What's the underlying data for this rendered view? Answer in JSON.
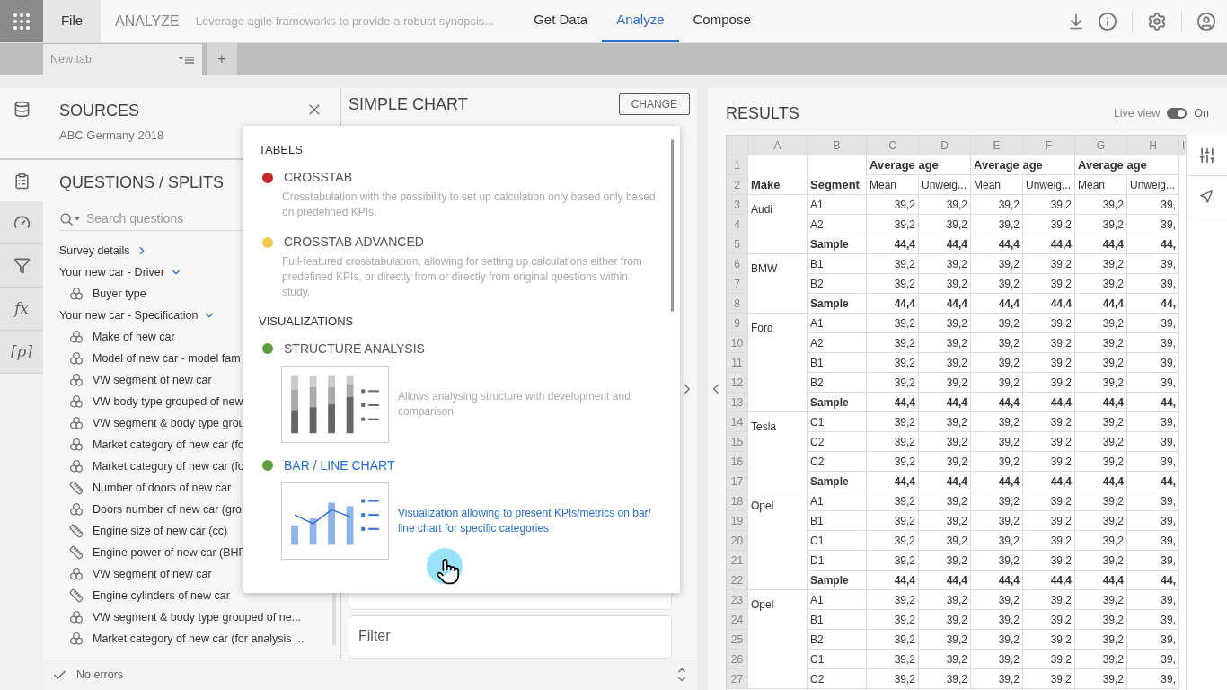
{
  "topbar": {
    "file_tab": "File",
    "title": "ANALYZE",
    "subtitle": "Leverage agile frameworks to provide a robust synopsis...",
    "nav": [
      {
        "label": "Get Data",
        "selected": false
      },
      {
        "label": "Analyze",
        "selected": true
      },
      {
        "label": "Compose",
        "selected": false
      }
    ]
  },
  "tabstrip": {
    "tabs": [
      {
        "label": "New tab"
      }
    ],
    "add_label": "+"
  },
  "rail": [
    {
      "kind": "gauge"
    },
    {
      "kind": "filter"
    },
    {
      "kind": "text",
      "label": "fx"
    },
    {
      "kind": "text",
      "label": "[p]"
    }
  ],
  "sources": {
    "title": "SOURCES",
    "subtitle": "ABC Germany 2018"
  },
  "questions": {
    "title": "QUESTIONS / SPLITS",
    "search": {
      "placeholder": "Search questions"
    },
    "groups": [
      {
        "label": "Survey details",
        "expanded": false
      },
      {
        "label": "Your new car - Driver",
        "expanded": true,
        "items": [
          {
            "label": "Buyer type",
            "kind": "categorical"
          }
        ]
      },
      {
        "label": "Your new car - Specification",
        "expanded": true,
        "items": [
          {
            "label": "Make of new car",
            "kind": "categorical"
          },
          {
            "label": "Model of new car - model fam",
            "kind": "categorical"
          },
          {
            "label": "VW segment of new car",
            "kind": "categorical"
          },
          {
            "label": "VW body type grouped of new",
            "kind": "categorical"
          },
          {
            "label": "VW segment & body type grou",
            "kind": "categorical"
          },
          {
            "label": "Market category of new car (fo",
            "kind": "categorical"
          },
          {
            "label": "Market category of new car (fo",
            "kind": "categorical"
          },
          {
            "label": "Number of doors of new car",
            "kind": "numeric"
          },
          {
            "label": "Doors number of new car (gro",
            "kind": "categorical"
          },
          {
            "label": "Engine size of new car (cc)",
            "kind": "numeric"
          },
          {
            "label": "Engine power of new car (BHP",
            "kind": "numeric"
          },
          {
            "label": "VW segment of new car",
            "kind": "categorical"
          },
          {
            "label": "Engine cylinders of new car",
            "kind": "numeric"
          },
          {
            "label": "VW segment & body type grouped of ne...",
            "kind": "categorical"
          },
          {
            "label": "Market category of new car (for analysis ...",
            "kind": "categorical"
          }
        ]
      }
    ]
  },
  "status_bar": {
    "text": "No errors"
  },
  "chart_panel": {
    "title": "SIMPLE CHART",
    "change_button": "CHANGE",
    "filter_label": "Filter"
  },
  "chart_type_menu": {
    "sections": [
      {
        "title": "TABELS",
        "items": [
          {
            "title": "CROSSTAB",
            "description": "Crosstabulation with the possibility to set up calculation only based only based on predefined KPIs.",
            "color": "#c62828",
            "selected": false,
            "kind": "plain"
          },
          {
            "title": "CROSSTAB ADVANCED",
            "description": "Full-featured crosstabulation, allowing for setting up calculations either from predefined KPIs, or directly from or directly from original questions within study.",
            "color": "#f2c94c",
            "selected": false,
            "kind": "plain"
          }
        ]
      },
      {
        "title": "VISUALIZATIONS",
        "items": [
          {
            "title": "STRUCTURE ANALYSIS",
            "description": "Allows analysing structure with development and comparison",
            "color": "#5a9e3a",
            "selected": false,
            "kind": "stacked"
          },
          {
            "title": "BAR / LINE CHART",
            "description": "Visualization allowing to present KPIs/metrics on bar/ line chart for specific categories",
            "color": "#5a9e3a",
            "selected": true,
            "kind": "barline"
          }
        ]
      }
    ]
  },
  "results": {
    "title": "RESULTS",
    "live_view": {
      "label": "Live view",
      "on": true,
      "state_label": "On"
    },
    "table": {
      "column_letters": [
        "A",
        "B",
        "C",
        "D",
        "E",
        "F",
        "G",
        "H",
        "I"
      ],
      "header_rows": [
        {
          "num": "1",
          "groups": [
            "Average age",
            "Average age",
            "Average age"
          ]
        },
        {
          "num": "2",
          "make": "Make",
          "segment": "Segment",
          "subheaders": [
            "Mean",
            "Unweig...",
            "Mean",
            "Unweig...",
            "Mean",
            "Unweig..."
          ]
        }
      ],
      "makes": [
        {
          "name": "Audi",
          "rows": [
            {
              "num": "3",
              "segment": "A1",
              "kind": "data",
              "values": [
                "39,2",
                "39,2",
                "39,2",
                "39,2",
                "39,2",
                "39,"
              ]
            },
            {
              "num": "4",
              "segment": "A2",
              "kind": "data",
              "values": [
                "39,2",
                "39,2",
                "39,2",
                "39,2",
                "39,2",
                "39,"
              ]
            },
            {
              "num": "5",
              "segment": "Sample",
              "kind": "total",
              "values": [
                "44,4",
                "44,4",
                "44,4",
                "44,4",
                "44,4",
                "44,"
              ]
            }
          ]
        },
        {
          "name": "BMW",
          "rows": [
            {
              "num": "6",
              "segment": "B1",
              "kind": "data",
              "values": [
                "39,2",
                "39,2",
                "39,2",
                "39,2",
                "39,2",
                "39,"
              ]
            },
            {
              "num": "7",
              "segment": "B2",
              "kind": "data",
              "values": [
                "39,2",
                "39,2",
                "39,2",
                "39,2",
                "39,2",
                "39,"
              ]
            },
            {
              "num": "8",
              "segment": "Sample",
              "kind": "total",
              "values": [
                "44,4",
                "44,4",
                "44,4",
                "44,4",
                "44,4",
                "44,"
              ]
            }
          ]
        },
        {
          "name": "Ford",
          "rows": [
            {
              "num": "9",
              "segment": "A1",
              "kind": "data",
              "values": [
                "39,2",
                "39,2",
                "39,2",
                "39,2",
                "39,2",
                "39,"
              ]
            },
            {
              "num": "10",
              "segment": "A2",
              "kind": "data",
              "values": [
                "39,2",
                "39,2",
                "39,2",
                "39,2",
                "39,2",
                "39,"
              ]
            },
            {
              "num": "11",
              "segment": "B1",
              "kind": "data",
              "values": [
                "39,2",
                "39,2",
                "39,2",
                "39,2",
                "39,2",
                "39,"
              ]
            },
            {
              "num": "12",
              "segment": "B2",
              "kind": "data",
              "values": [
                "39,2",
                "39,2",
                "39,2",
                "39,2",
                "39,2",
                "39,"
              ]
            },
            {
              "num": "13",
              "segment": "Sample",
              "kind": "total",
              "values": [
                "44,4",
                "44,4",
                "44,4",
                "44,4",
                "44,4",
                "44,"
              ]
            }
          ]
        },
        {
          "name": "Tesla",
          "rows": [
            {
              "num": "14",
              "segment": "C1",
              "kind": "data",
              "values": [
                "39,2",
                "39,2",
                "39,2",
                "39,2",
                "39,2",
                "39,"
              ]
            },
            {
              "num": "15",
              "segment": "C2",
              "kind": "data",
              "values": [
                "39,2",
                "39,2",
                "39,2",
                "39,2",
                "39,2",
                "39,"
              ]
            },
            {
              "num": "16",
              "segment": "C2",
              "kind": "data",
              "values": [
                "39,2",
                "39,2",
                "39,2",
                "39,2",
                "39,2",
                "39,"
              ]
            },
            {
              "num": "17",
              "segment": "Sample",
              "kind": "total",
              "values": [
                "44,4",
                "44,4",
                "44,4",
                "44,4",
                "44,4",
                "44,"
              ]
            }
          ]
        },
        {
          "name": "Opel",
          "rows": [
            {
              "num": "18",
              "segment": "A1",
              "kind": "data",
              "values": [
                "39,2",
                "39,2",
                "39,2",
                "39,2",
                "39,2",
                "39,"
              ]
            },
            {
              "num": "19",
              "segment": "B1",
              "kind": "data",
              "values": [
                "39,2",
                "39,2",
                "39,2",
                "39,2",
                "39,2",
                "39,"
              ]
            },
            {
              "num": "20",
              "segment": "C1",
              "kind": "data",
              "values": [
                "39,2",
                "39,2",
                "39,2",
                "39,2",
                "39,2",
                "39,"
              ]
            },
            {
              "num": "21",
              "segment": "D1",
              "kind": "data",
              "values": [
                "39,2",
                "39,2",
                "39,2",
                "39,2",
                "39,2",
                "39,"
              ]
            },
            {
              "num": "22",
              "segment": "Sample",
              "kind": "total",
              "values": [
                "44,4",
                "44,4",
                "44,4",
                "44,4",
                "44,4",
                "44,"
              ]
            }
          ]
        },
        {
          "name": "Opel",
          "rows": [
            {
              "num": "23",
              "segment": "A1",
              "kind": "data",
              "values": [
                "39,2",
                "39,2",
                "39,2",
                "39,2",
                "39,2",
                "39,"
              ]
            },
            {
              "num": "24",
              "segment": "B1",
              "kind": "data",
              "values": [
                "39,2",
                "39,2",
                "39,2",
                "39,2",
                "39,2",
                "39,"
              ]
            },
            {
              "num": "25",
              "segment": "B2",
              "kind": "data",
              "values": [
                "39,2",
                "39,2",
                "39,2",
                "39,2",
                "39,2",
                "39,"
              ]
            },
            {
              "num": "26",
              "segment": "C1",
              "kind": "data",
              "values": [
                "39,2",
                "39,2",
                "39,2",
                "39,2",
                "39,2",
                "39,"
              ]
            },
            {
              "num": "27",
              "segment": "C2",
              "kind": "data",
              "values": [
                "39,2",
                "39,2",
                "39,2",
                "39,2",
                "39,2",
                "39,"
              ]
            }
          ]
        }
      ]
    }
  }
}
